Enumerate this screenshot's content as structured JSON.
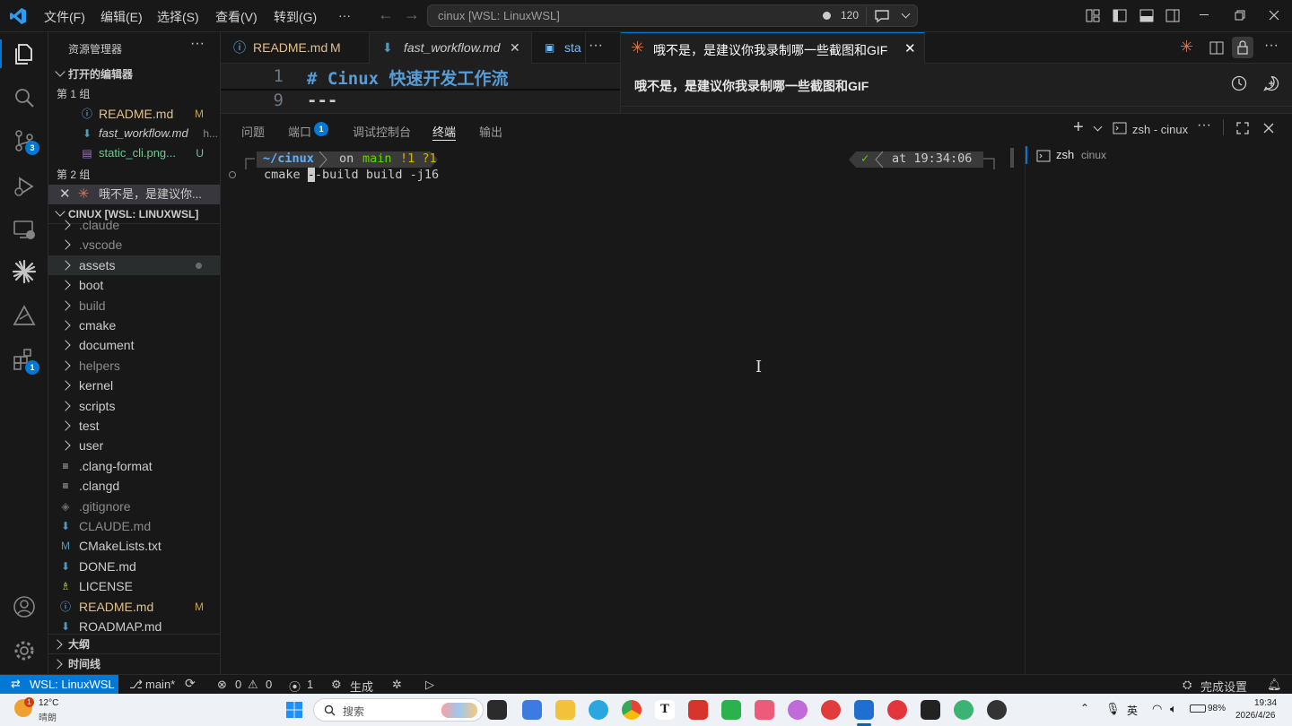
{
  "titlebar": {
    "menus": [
      "文件(F)",
      "编辑(E)",
      "选择(S)",
      "查看(V)",
      "转到(G)",
      "···"
    ],
    "command_center": "cinux [WSL: LinuxWSL]",
    "count": "120"
  },
  "activity": {
    "scm_badge": "3",
    "ext_badge": "1"
  },
  "sidebar": {
    "title": "资源管理器",
    "open_editors_header": "打开的编辑器",
    "group1": "第 1 组",
    "group1_items": [
      {
        "label": "README.md",
        "status": "M"
      },
      {
        "label": "fast_workflow.md",
        "status": "h..."
      },
      {
        "label": "static_cli.png...",
        "status": "U"
      }
    ],
    "group2": "第 2 组",
    "group2_item": "哦不是，是建议你...",
    "workspace_header": "CINUX [WSL: LINUXWSL]",
    "tree": [
      {
        "label": ".claude",
        "kind": "folder"
      },
      {
        "label": ".vscode",
        "kind": "folder"
      },
      {
        "label": "assets",
        "kind": "folder"
      },
      {
        "label": "boot",
        "kind": "folder"
      },
      {
        "label": "build",
        "kind": "folder"
      },
      {
        "label": "cmake",
        "kind": "folder"
      },
      {
        "label": "document",
        "kind": "folder"
      },
      {
        "label": "helpers",
        "kind": "folder"
      },
      {
        "label": "kernel",
        "kind": "folder"
      },
      {
        "label": "scripts",
        "kind": "folder"
      },
      {
        "label": "test",
        "kind": "folder"
      },
      {
        "label": "user",
        "kind": "folder"
      },
      {
        "label": ".clang-format",
        "kind": "file"
      },
      {
        "label": ".clangd",
        "kind": "file"
      },
      {
        "label": ".gitignore",
        "kind": "file"
      },
      {
        "label": "CLAUDE.md",
        "kind": "file"
      },
      {
        "label": "CMakeLists.txt",
        "kind": "file"
      },
      {
        "label": "DONE.md",
        "kind": "file"
      },
      {
        "label": "LICENSE",
        "kind": "file"
      },
      {
        "label": "README.md",
        "kind": "file",
        "status": "M"
      },
      {
        "label": "ROADMAP.md",
        "kind": "file"
      }
    ],
    "outline": "大纲",
    "timeline": "时间线"
  },
  "editor": {
    "tabs": [
      {
        "label": "README.md",
        "status": "M"
      },
      {
        "label": "fast_workflow.md"
      },
      {
        "label": "sta"
      }
    ],
    "lines": [
      {
        "num": "1",
        "text": "# Cinux 快速开发工作流"
      },
      {
        "num": "9",
        "text": "---"
      }
    ]
  },
  "chat": {
    "tab_title": "哦不是，是建议你我录制哪一些截图和GIF",
    "heading": "哦不是，是建议你我录制哪一些截图和GIF"
  },
  "panel": {
    "tabs": [
      "问题",
      "端口",
      "调试控制台",
      "终端",
      "输出"
    ],
    "ports_badge": "1",
    "terminal_label": "zsh - cinux",
    "prompt_path": "~/cinux",
    "prompt_on": "on",
    "prompt_branch": "main",
    "prompt_flags": "!1 ?1",
    "prompt_check": "✓",
    "prompt_time": "at 19:34:06",
    "command_pre": "cmake ",
    "command_cursor": "-",
    "command_post": "-build build -j16",
    "term_list_item": "zsh",
    "term_list_sub": "cinux"
  },
  "status": {
    "remote": "WSL: LinuxWSL",
    "branch": "main*",
    "errors": "0",
    "warnings": "0",
    "ports": "1",
    "build": "生成",
    "setup": "完成设置"
  },
  "taskbar": {
    "weather_temp": "12°C",
    "weather_desc": "晴朗",
    "search": "搜索",
    "ime": "英",
    "battery": "98%",
    "time": "19:34",
    "date": "2026/4/26"
  }
}
